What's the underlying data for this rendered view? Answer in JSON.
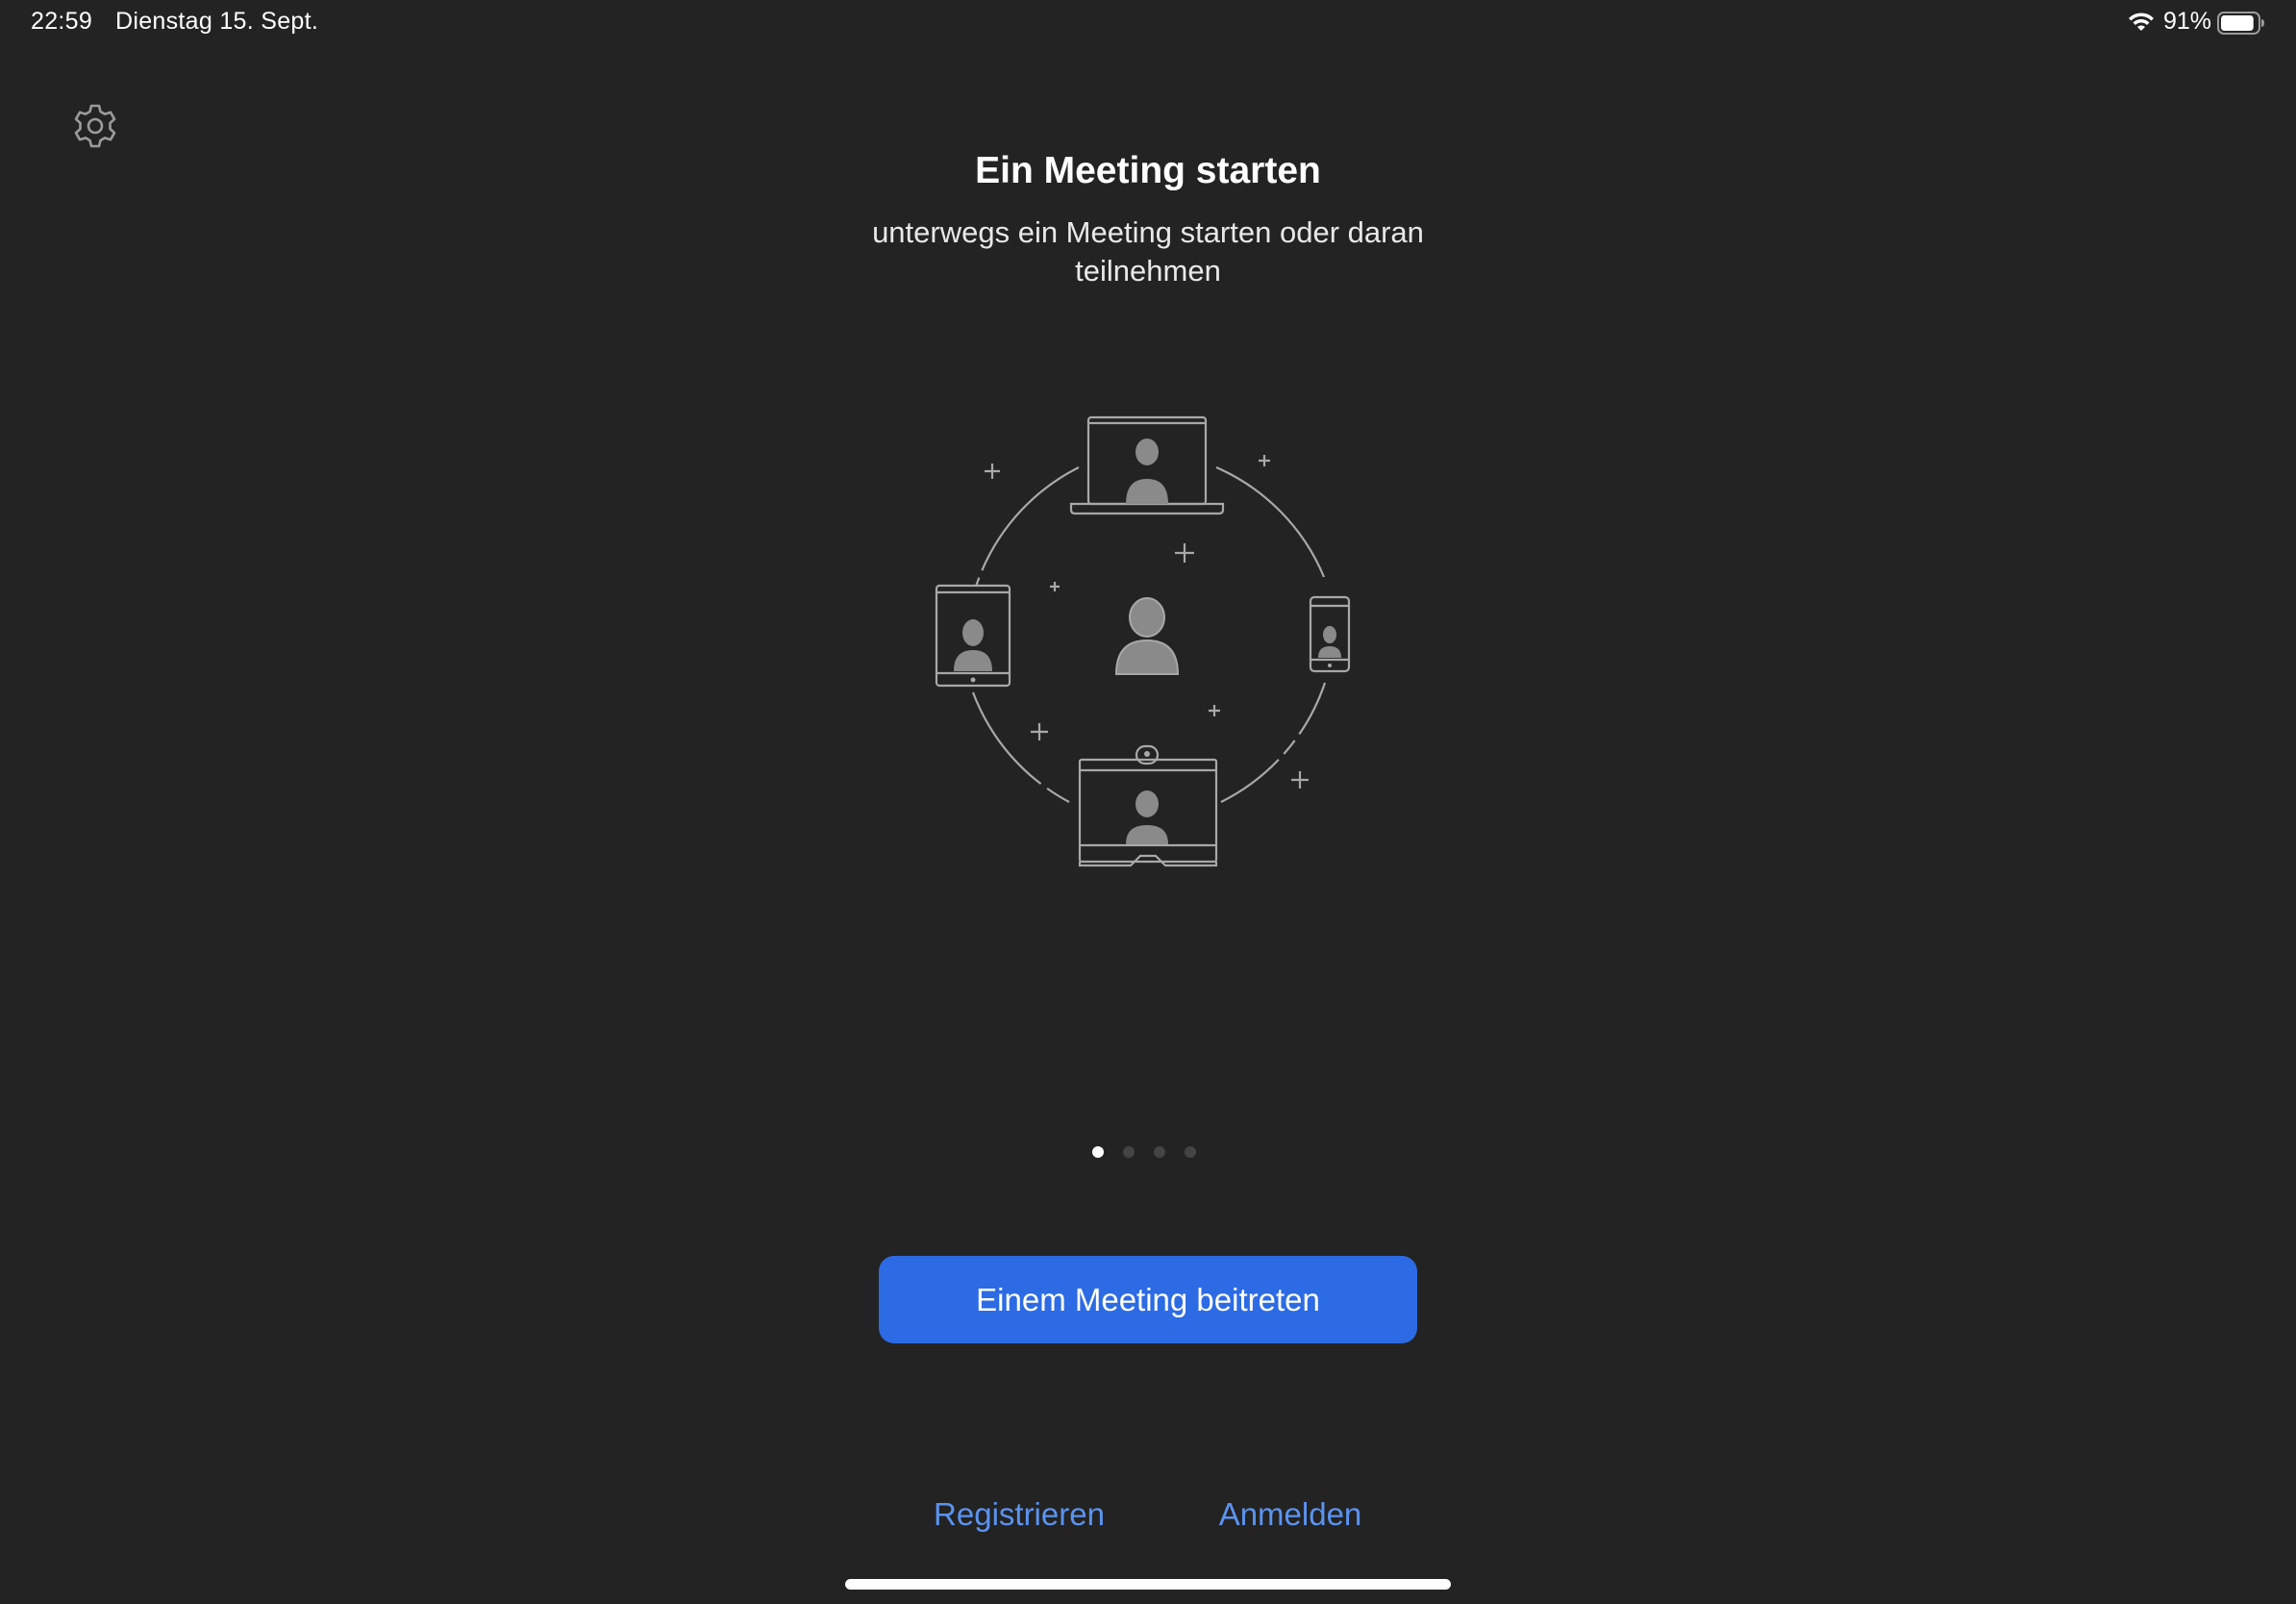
{
  "status_bar": {
    "time": "22:59",
    "date": "Dienstag 15. Sept.",
    "battery_percent": "91%",
    "battery_level": 0.91,
    "wifi_icon": "wifi-icon",
    "battery_icon": "battery-icon"
  },
  "settings": {
    "icon": "gear-icon"
  },
  "onboarding": {
    "title": "Ein Meeting starten",
    "subtitle": "unterwegs ein Meeting starten oder daran teilnehmen",
    "page_count": 4,
    "current_page": 1
  },
  "actions": {
    "join_label": "Einem Meeting beitreten",
    "register_label": "Registrieren",
    "signin_label": "Anmelden"
  },
  "colors": {
    "background": "#232323",
    "primary_button": "#2d6be4",
    "link": "#5b93f0"
  }
}
